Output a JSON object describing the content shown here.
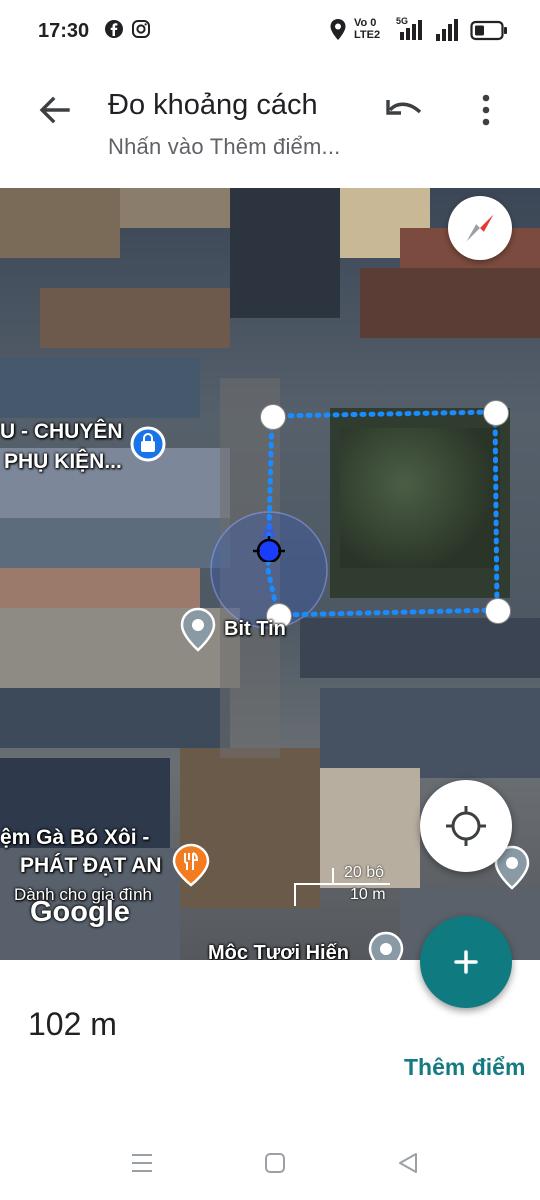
{
  "status_bar": {
    "time": "17:30",
    "network_label_1": "Vo",
    "network_label_2": "LTE",
    "network_label_3": "5G"
  },
  "app_bar": {
    "title": "Đo khoảng cách",
    "subtitle": "Nhấn vào Thêm điểm..."
  },
  "map": {
    "labels": {
      "shop_line1": "U - CHUYÊN",
      "shop_line2": "PHỤ KIỆN...",
      "place_bit": "Bit Tin",
      "food_line1": "ệm Gà Bó Xôi -",
      "food_line2": "PHÁT ĐẠT AN",
      "food_line3": "Dành cho gia đình",
      "place_moc": "Mộc Tươi Hiến"
    },
    "google_logo": "Google",
    "scale": {
      "top": "20 bộ",
      "bottom": "10 m"
    }
  },
  "bottom_panel": {
    "distance": "102 m",
    "add_point": "Thêm điểm"
  },
  "colors": {
    "accent": "#167a83",
    "fab": "#0f7a80",
    "measure_line": "#1a8cff",
    "location_dot": "#1a3cff"
  }
}
